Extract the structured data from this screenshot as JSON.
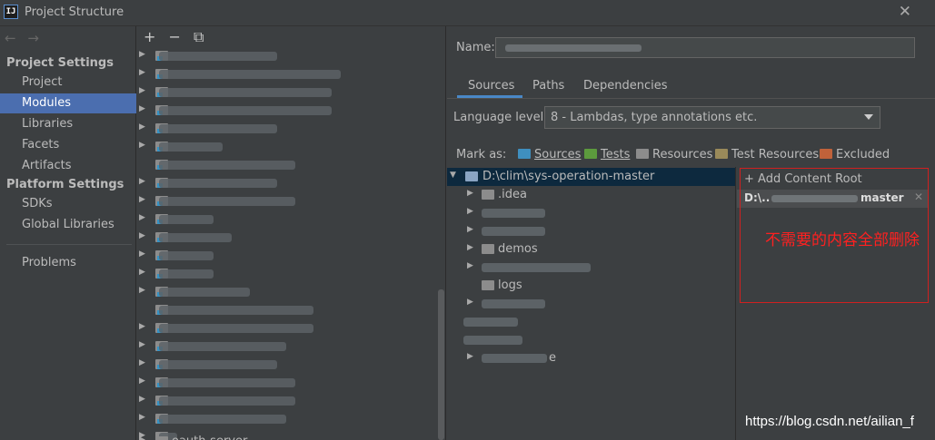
{
  "window": {
    "app_icon": "IJ",
    "title": "Project Structure",
    "close_glyph": "✕"
  },
  "nav": {
    "back": "←",
    "forward": "→"
  },
  "sidebar": {
    "project_settings_header": "Project Settings",
    "project_settings_items": [
      "Project",
      "Modules",
      "Libraries",
      "Facets",
      "Artifacts"
    ],
    "selected_item": "Modules",
    "platform_settings_header": "Platform Settings",
    "platform_settings_items": [
      "SDKs",
      "Global Libraries"
    ],
    "problems": "Problems"
  },
  "module_toolbar": {
    "add": "+",
    "remove": "−",
    "copy": "⧉"
  },
  "module_list": {
    "last_visible_item": "oauth-server"
  },
  "name_field": {
    "label": "Name:",
    "value": ""
  },
  "tabs": [
    "Sources",
    "Paths",
    "Dependencies"
  ],
  "active_tab": "Sources",
  "language_level": {
    "label": "Language level:",
    "value": "8 - Lambdas, type annotations etc."
  },
  "mark_as": {
    "label": "Mark as:",
    "buttons": [
      {
        "label": "Sources",
        "color": "#3f8fbf"
      },
      {
        "label": "Tests",
        "color": "#5c9a3d"
      },
      {
        "label": "Resources",
        "color": "#8c8c8c"
      },
      {
        "label": "Test Resources",
        "color": "#9a8a5a"
      },
      {
        "label": "Excluded",
        "color": "#c0623a"
      }
    ]
  },
  "content_tree": {
    "root": "D:\\clim\\sys-operation-master",
    "children": [
      ".idea",
      "demos",
      "logs"
    ],
    "partial_suffix": "e"
  },
  "content_roots": {
    "add_label": "Add Content Root",
    "root_prefix": "D:\\..",
    "root_suffix": "master",
    "remove_glyph": "✕"
  },
  "annotation": {
    "text": "不需要的内容全部删除"
  },
  "watermark": "https://blog.csdn.net/ailian_f"
}
